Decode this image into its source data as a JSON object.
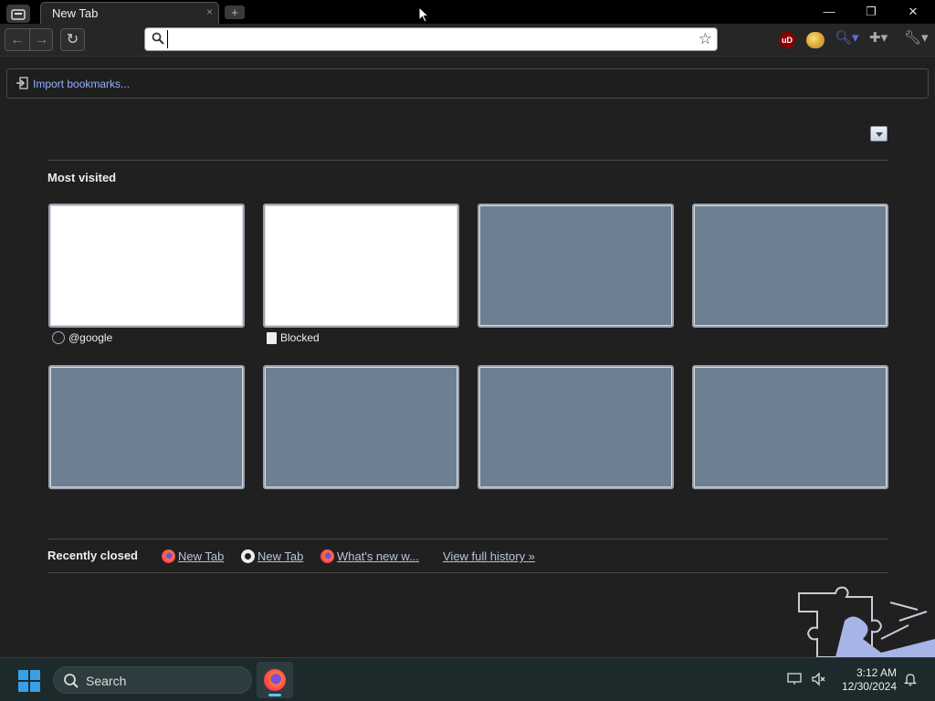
{
  "browser": {
    "tab": {
      "title": "New Tab",
      "close_glyph": "×"
    },
    "newtab_glyph": "+",
    "window_controls": {
      "minimize": "—",
      "restore": "❐",
      "close": "✕"
    },
    "toolbar": {
      "back_glyph": "←",
      "forward_glyph": "→",
      "reload_glyph": "↻",
      "omnibox_value": "",
      "star_glyph": "☆",
      "extensions": {
        "ublock_label": "uD",
        "search_glyph": "🔍︎▾",
        "puzzle_glyph": "✚▾",
        "wrench_glyph": "🔧︎▾"
      }
    },
    "bookmarks_bar": {
      "import_label": "Import bookmarks..."
    }
  },
  "newtab": {
    "most_visited_title": "Most visited",
    "tiles": [
      {
        "label": "@google",
        "icon": "globe-icon",
        "filled": true
      },
      {
        "label": "Blocked",
        "icon": "page-icon",
        "filled": true
      },
      {
        "label": "",
        "filled": false
      },
      {
        "label": "",
        "filled": false
      },
      {
        "label": "",
        "filled": false
      },
      {
        "label": "",
        "filled": false
      },
      {
        "label": "",
        "filled": false
      },
      {
        "label": "",
        "filled": false
      }
    ],
    "recently_closed": {
      "title": "Recently closed",
      "items": [
        {
          "label": "New Tab",
          "icon": "firefox-icon"
        },
        {
          "label": "New Tab",
          "icon": "github-icon"
        },
        {
          "label": "What's new w...",
          "icon": "firefox-icon"
        }
      ],
      "view_full_history": "View full history »"
    }
  },
  "taskbar": {
    "search_label": "Search",
    "clock_time": "3:12 AM",
    "clock_date": "12/30/2024"
  }
}
